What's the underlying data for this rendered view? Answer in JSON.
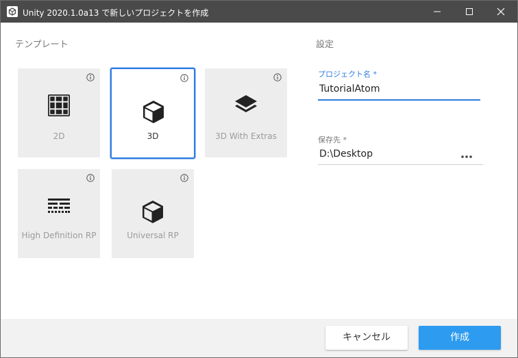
{
  "window": {
    "title": "Unity 2020.1.0a13 で新しいプロジェクトを作成",
    "icon": "unity-logo-icon",
    "controls": [
      "minimize-icon",
      "maximize-icon",
      "close-icon"
    ]
  },
  "templates": {
    "heading": "テンプレート",
    "items": [
      {
        "label": "2D",
        "icon": "grid-icon",
        "selected": false
      },
      {
        "label": "3D",
        "icon": "cube-icon",
        "selected": true
      },
      {
        "label": "3D With Extras",
        "icon": "layers-icon",
        "selected": false
      },
      {
        "label": "High Definition RP",
        "icon": "hdrp-lines-icon",
        "selected": false
      },
      {
        "label": "Universal RP",
        "icon": "cube-icon",
        "selected": false
      }
    ]
  },
  "settings": {
    "heading": "設定",
    "project_name_label": "プロジェクト名 *",
    "project_name_value": "TutorialAtom",
    "location_label": "保存先 *",
    "location_value": "D:\\Desktop",
    "more_icon": "ellipsis-icon"
  },
  "footer": {
    "cancel_label": "キャンセル",
    "create_label": "作成"
  },
  "colors": {
    "accent": "#2d7ce0",
    "create_button": "#2d9bef",
    "titlebar": "#4a4a4a"
  }
}
